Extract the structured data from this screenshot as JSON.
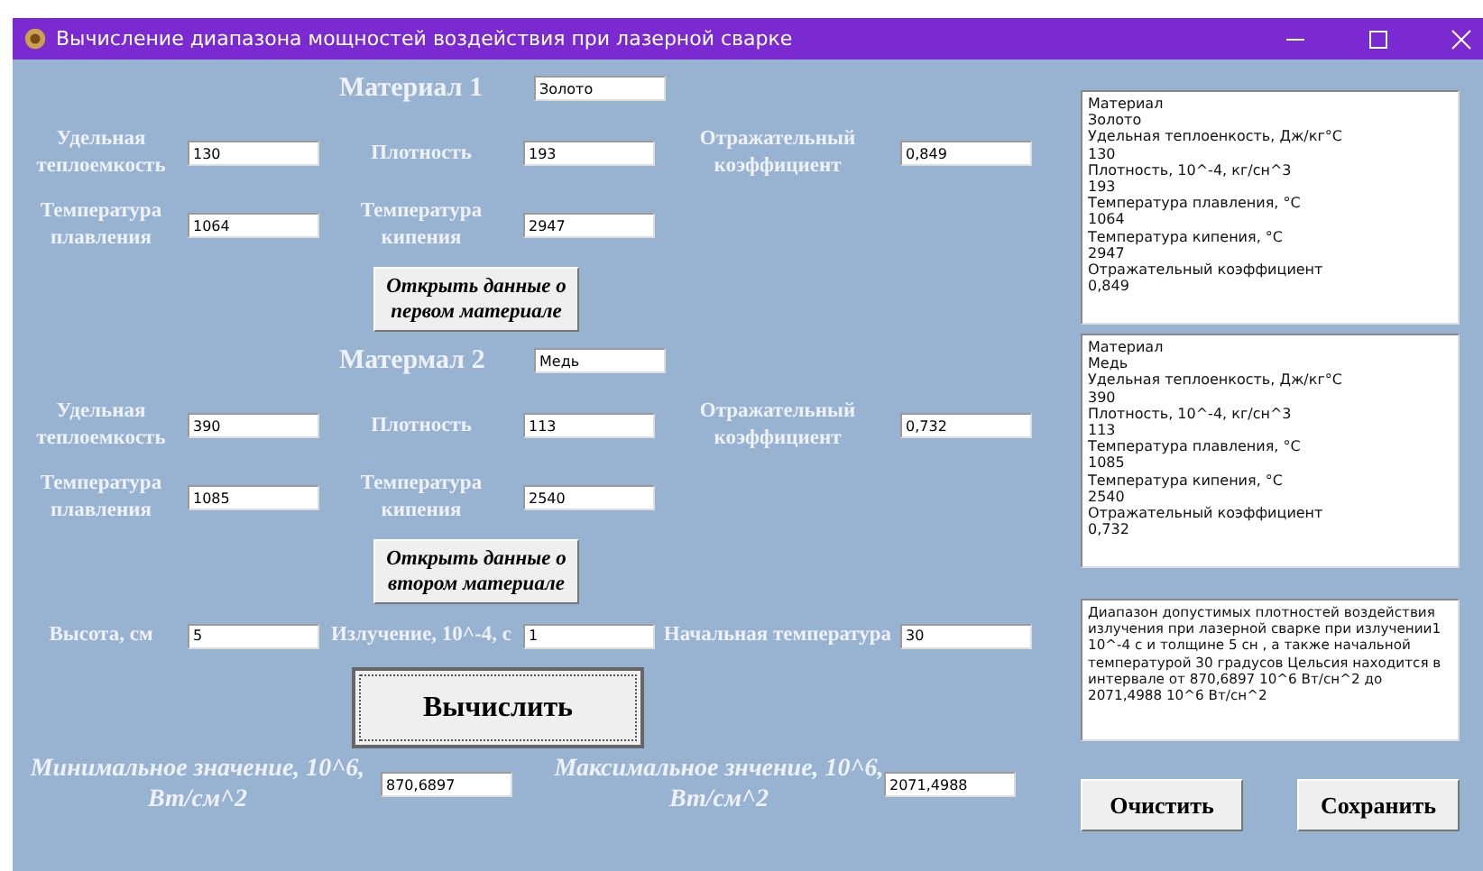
{
  "window": {
    "title": "Вычисление диапазона мощностей воздействия при лазерной сварке"
  },
  "materials": [
    {
      "heading": "Материал 1",
      "name": "Золото",
      "fields": [
        {
          "label": "Удельная теплоемкость",
          "value": "130"
        },
        {
          "label": "Плотность",
          "value": "193"
        },
        {
          "label": "Отражательный коэффициент",
          "value": "0,849"
        },
        {
          "label": "Температура плавления",
          "value": "1064"
        },
        {
          "label": "Температура кипения",
          "value": "2947"
        }
      ],
      "open_button": "Открыть данные о первом материале"
    },
    {
      "heading": "Матермал 2",
      "name": "Медь",
      "fields": [
        {
          "label": "Удельная теплоемкость",
          "value": "390"
        },
        {
          "label": "Плотность",
          "value": "113"
        },
        {
          "label": "Отражательный коэффициент",
          "value": "0,732"
        },
        {
          "label": "Температура плавления",
          "value": "1085"
        },
        {
          "label": "Температура кипения",
          "value": "2540"
        }
      ],
      "open_button": "Открыть данные о втором материале"
    }
  ],
  "process_fields": [
    {
      "label": "Высота, см",
      "value": "5"
    },
    {
      "label": "Излучение, 10^-4, с",
      "value": "1"
    },
    {
      "label": "Начальная температура",
      "value": "30"
    }
  ],
  "calculate_button": "Вычислить",
  "results": [
    {
      "label": "Минимальное значение, 10^6, Вт/см^2",
      "value": "870,6897"
    },
    {
      "label": "Максимальное знчение, 10^6, Вт/см^2",
      "value": "2071,4988"
    }
  ],
  "info_panels": [
    {
      "lines": [
        "Материал",
        "Золото",
        "Удельная теплоенкость, Дж/кг°С",
        "130",
        "Плотность, 10^-4, кг/сн^3",
        "193",
        "Температура плавления, °С",
        "1064",
        "Температура кипения, °С",
        "2947",
        "Отражательный коэффициент",
        "0,849"
      ]
    },
    {
      "lines": [
        "Материал",
        "Медь",
        "Удельная теплоенкость, Дж/кг°С",
        "390",
        "Плотность, 10^-4, кг/сн^3",
        "113",
        "Температура плавления, °С",
        "1085",
        "Температура кипения, °С",
        "2540",
        "Отражательный коэффициент",
        "0,732"
      ]
    }
  ],
  "result_text": "Диапазон допустимых плотностей воздействия излучения при лазерной сварке при излучении1 10^-4 с и толщине 5 сн , а также начальной температурой 30 градусов Цельсия находится в интервале от 870,6897 10^6 Вт/сн^2 до 2071,4988 10^6 Вт/сн^2",
  "buttons": [
    "Очистить",
    "Сохранить"
  ]
}
